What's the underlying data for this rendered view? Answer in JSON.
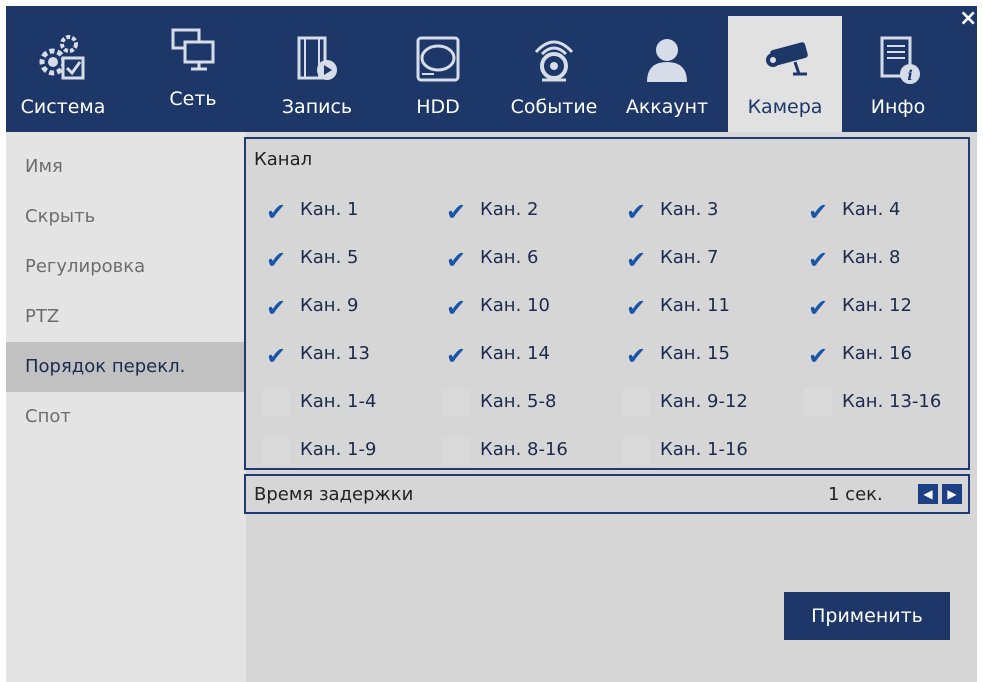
{
  "tabs": [
    {
      "label": "Система",
      "icon": "gear-check-icon"
    },
    {
      "label": "Сеть",
      "icon": "network-monitor-icon"
    },
    {
      "label": "Запись",
      "icon": "film-play-icon"
    },
    {
      "label": "HDD",
      "icon": "hard-drive-icon"
    },
    {
      "label": "Событие",
      "icon": "alarm-event-icon"
    },
    {
      "label": "Аккаунт",
      "icon": "user-icon"
    },
    {
      "label": "Камера",
      "icon": "camera-icon",
      "active": true
    },
    {
      "label": "Инфо",
      "icon": "document-info-icon"
    }
  ],
  "close_label": "×",
  "sidebar": {
    "items": [
      {
        "label": "Имя"
      },
      {
        "label": "Скрыть"
      },
      {
        "label": "Регулировка"
      },
      {
        "label": "PTZ"
      },
      {
        "label": "Порядок перекл.",
        "active": true
      },
      {
        "label": "Спот"
      }
    ]
  },
  "channel_section": {
    "title": "Канал",
    "checkboxes": [
      {
        "label": "Кан. 1",
        "checked": true
      },
      {
        "label": "Кан. 2",
        "checked": true
      },
      {
        "label": "Кан. 3",
        "checked": true
      },
      {
        "label": "Кан. 4",
        "checked": true
      },
      {
        "label": "Кан. 5",
        "checked": true
      },
      {
        "label": "Кан. 6",
        "checked": true
      },
      {
        "label": "Кан. 7",
        "checked": true
      },
      {
        "label": "Кан. 8",
        "checked": true
      },
      {
        "label": "Кан. 9",
        "checked": true
      },
      {
        "label": "Кан. 10",
        "checked": true
      },
      {
        "label": "Кан. 11",
        "checked": true
      },
      {
        "label": "Кан. 12",
        "checked": true
      },
      {
        "label": "Кан. 13",
        "checked": true
      },
      {
        "label": "Кан. 14",
        "checked": true
      },
      {
        "label": "Кан. 15",
        "checked": true
      },
      {
        "label": "Кан. 16",
        "checked": true
      },
      {
        "label": "Кан. 1-4",
        "checked": false
      },
      {
        "label": "Кан. 5-8",
        "checked": false
      },
      {
        "label": "Кан. 9-12",
        "checked": false
      },
      {
        "label": "Кан. 13-16",
        "checked": false
      },
      {
        "label": "Кан. 1-9",
        "checked": false
      },
      {
        "label": "Кан. 8-16",
        "checked": false
      },
      {
        "label": "Кан. 1-16",
        "checked": false
      }
    ],
    "check_glyph": "✔"
  },
  "delay": {
    "label": "Время задержки",
    "value": "1 сек.",
    "prev_glyph": "◀",
    "next_glyph": "▶"
  },
  "apply_label": "Применить",
  "colors": {
    "topbar": "#1d3769",
    "accent": "#1c54a8",
    "active_tab": "#e1e1e1"
  }
}
